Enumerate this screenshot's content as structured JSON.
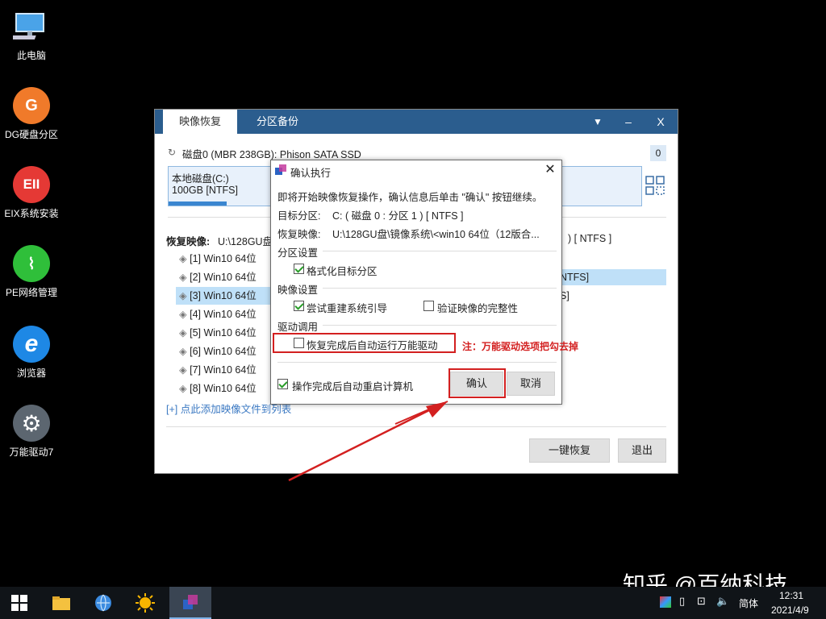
{
  "desktop": {
    "icons": [
      {
        "label": "此电脑",
        "icon": "computer-icon"
      },
      {
        "label": "DG硬盘分区",
        "icon": "dg-icon",
        "glyph": "G",
        "color": "#f07a2a"
      },
      {
        "label": "EIX系统安装",
        "icon": "eix-icon",
        "glyph": "EII",
        "color": "#e53935"
      },
      {
        "label": "PE网络管理",
        "icon": "network-icon",
        "glyph": "⌇",
        "color": "#2fbf3a"
      },
      {
        "label": "浏览器",
        "icon": "ie-icon",
        "glyph": "e",
        "color": "#1e88e5"
      },
      {
        "label": "万能驱动7",
        "icon": "gear-icon",
        "glyph": "⚙",
        "color": "#5c6670"
      }
    ]
  },
  "main_window": {
    "tabs": [
      "映像恢复",
      "分区备份"
    ],
    "controls": {
      "menu": "▼",
      "minimize": "–",
      "close": "X"
    },
    "disk_label": "磁盘0 (MBR 238GB): Phison SATA SSD",
    "disk_count": "0",
    "partition": {
      "name": "本地磁盘(C:)",
      "size": "100GB [NTFS]"
    },
    "restore_label": "恢复映像:",
    "restore_path": "U:\\128GU盘",
    "right_fs": ") [ NTFS ]",
    "right_row2": "NTFS]",
    "right_row3": "S]",
    "images": [
      "[1] Win10 64位",
      "[2] Win10 64位",
      "[3] Win10 64位",
      "[4] Win10 64位",
      "[5] Win10 64位",
      "[6] Win10 64位",
      "[7] Win10 64位",
      "[8] Win10 64位"
    ],
    "add_link": "[+] 点此添加映像文件到列表",
    "btn_restore": "一键恢复",
    "btn_exit": "退出"
  },
  "dialog": {
    "title": "确认执行",
    "intro": "即将开始映像恢复操作，确认信息后单击 \"确认\" 按钮继续。",
    "target_label": "目标分区:",
    "target_value": "C: ( 磁盘 0 : 分区 1 ) [ NTFS ]",
    "image_label": "恢复映像:",
    "image_value": "U:\\128GU盘\\镜像系统\\<win10 64位（12版合...",
    "sec_partition": "分区设置",
    "opt_format": "格式化目标分区",
    "sec_image": "映像设置",
    "opt_rebuild": "尝试重建系统引导",
    "opt_verify": "验证映像的完整性",
    "sec_driver": "驱动调用",
    "opt_driver": "恢复完成后自动运行万能驱动",
    "opt_reboot": "操作完成后自动重启计算机",
    "btn_ok": "确认",
    "btn_cancel": "取消"
  },
  "annotation": {
    "note": "注：万能驱动选项把勾去掉",
    "color": "#d32020"
  },
  "watermark": "知乎 @百纳科技",
  "taskbar": {
    "lang": "简体",
    "time": "12:31",
    "date": "2021/4/9"
  }
}
